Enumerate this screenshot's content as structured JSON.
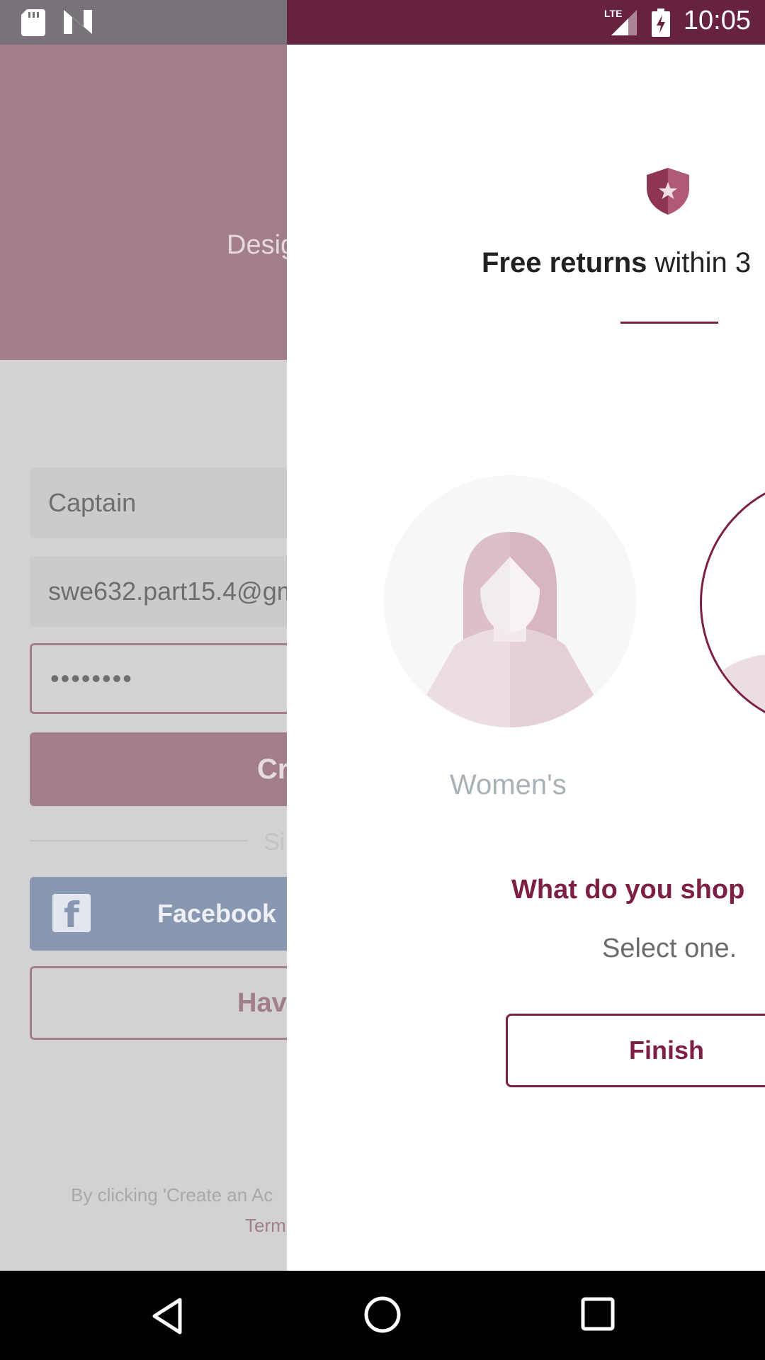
{
  "status_bar": {
    "time": "10:05",
    "network": "LTE",
    "icons": [
      "sd-card-icon",
      "n-logo-icon",
      "lte-signal-icon",
      "battery-charging-icon"
    ]
  },
  "background_screen": {
    "tagline": "Desig",
    "first_name_value": "Captain",
    "email_value": "swe632.part15.4@gm",
    "password_value": "••••••••",
    "create_button_label": "Cr",
    "divider_text": "Si",
    "facebook_button_label": "Facebook",
    "have_account_button_label": "Have",
    "terms_text": "By clicking 'Create an Ac",
    "terms_link": "Term"
  },
  "drawer": {
    "returns_bold": "Free returns",
    "returns_rest": " within 3",
    "women_label": "Women's",
    "question": "What do you shop",
    "instruction": "Select one.",
    "finish_label": "Finish"
  },
  "colors": {
    "brand": "#7d2046",
    "status_bar": "#672240",
    "overlay_header": "#a17e8a"
  },
  "nav_bar": {
    "icons": [
      "back-icon",
      "home-icon",
      "recents-icon"
    ]
  }
}
